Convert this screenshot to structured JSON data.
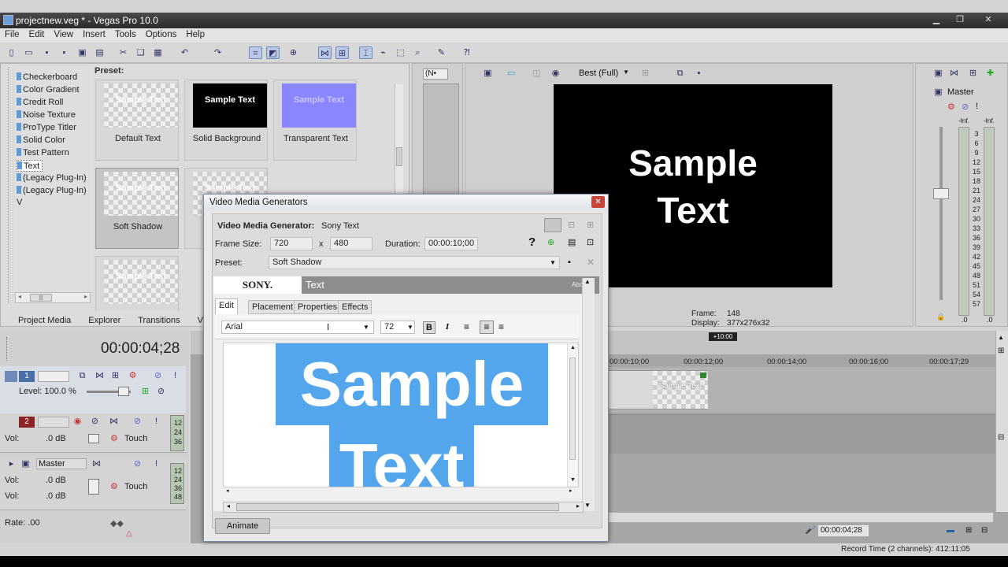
{
  "window": {
    "title": "projectnew.veg * - Vegas Pro 10.0"
  },
  "menu": [
    "File",
    "Edit",
    "View",
    "Insert",
    "Tools",
    "Options",
    "Help"
  ],
  "media_generators": {
    "items": [
      "Checkerboard",
      "Color Gradient",
      "Credit Roll",
      "Noise Texture",
      "ProType Titler",
      "Solid Color",
      "Test Pattern",
      "Text",
      "(Legacy Plug-In) T",
      "(Legacy Plug-In) V"
    ],
    "selected": "Text",
    "preset_heading": "Preset:",
    "presets": [
      {
        "thumb": "Sample Text",
        "caption": "Default Text"
      },
      {
        "thumb": "Sample Text",
        "caption": "Solid Background"
      },
      {
        "thumb": "Sample Text",
        "caption": "Transparent Text"
      },
      {
        "thumb": "Sample Text",
        "caption": "Soft Shadow"
      },
      {
        "thumb": "Sample Text",
        "caption": ""
      },
      {
        "thumb": "Sample Text",
        "caption": ""
      }
    ],
    "scroll_grip": "|||"
  },
  "window_tabs": [
    "Project Media",
    "Explorer",
    "Transitions",
    "Vi"
  ],
  "preview": {
    "filter_value": "(N•",
    "quality": "Best (Full)",
    "sample_line1": "Sample",
    "sample_line2": "Text",
    "frame_label": "Frame:",
    "frame_value": "148",
    "display_label": "Display:",
    "display_value": "377x276x32"
  },
  "mixer": {
    "title": "Master",
    "inf_left": "-Inf.",
    "inf_right": "-Inf.",
    "scale": [
      "3",
      "6",
      "9",
      "12",
      "15",
      "18",
      "21",
      "24",
      "27",
      "30",
      "33",
      "36",
      "39",
      "42",
      "45",
      "48",
      "51",
      "54",
      "57"
    ],
    "bottom_left": ".0",
    "bottom_right": ".0"
  },
  "timeline": {
    "cursor_time": "00:00:04;28",
    "region_label": "+10:00",
    "ruler": [
      "00:00:10;00",
      "00:00:12;00",
      "00:00:14;00",
      "00:00:16;00",
      "00:00:17;29"
    ],
    "event_text": "Sample Text",
    "status_time": "00:00:04;28",
    "record_time": "Record Time (2 channels): 412:11:05"
  },
  "tracks": {
    "video": {
      "number": "1",
      "level": "Level: 100.0 %"
    },
    "audio": {
      "number": "2",
      "vol_label": "Vol:",
      "vol_value": ".0 dB",
      "mode": "Touch",
      "meter": [
        "12",
        "24",
        "36"
      ]
    },
    "master": {
      "name": "Master",
      "vol_label": "Vol:",
      "vol_value": ".0 dB",
      "mode": "Touch",
      "meter": [
        "12",
        "24",
        "36",
        "48"
      ]
    },
    "rate": "Rate: .00"
  },
  "dialog": {
    "title": "Video Media Generators",
    "generator_label": "Video Media Generator:",
    "generator_value": "Sony Text",
    "frame_size_label": "Frame Size:",
    "width": "720",
    "x": "x",
    "height": "480",
    "duration_label": "Duration:",
    "duration_value": "00:00:10;00",
    "preset_label": "Preset:",
    "preset_value": "Soft Shadow",
    "brand": "SONY.",
    "plugin_name": "Text",
    "about": "About",
    "tabs": [
      "Edit",
      "Placement",
      "Properties",
      "Effects"
    ],
    "font": "Arial",
    "size": "72",
    "bold": "B",
    "italic": "I",
    "text_line1": "Sample",
    "text_line2": "Text",
    "animate": "Animate"
  },
  "colors": {
    "highlight": "#53a6ec",
    "accent": "#6f8ab8"
  }
}
